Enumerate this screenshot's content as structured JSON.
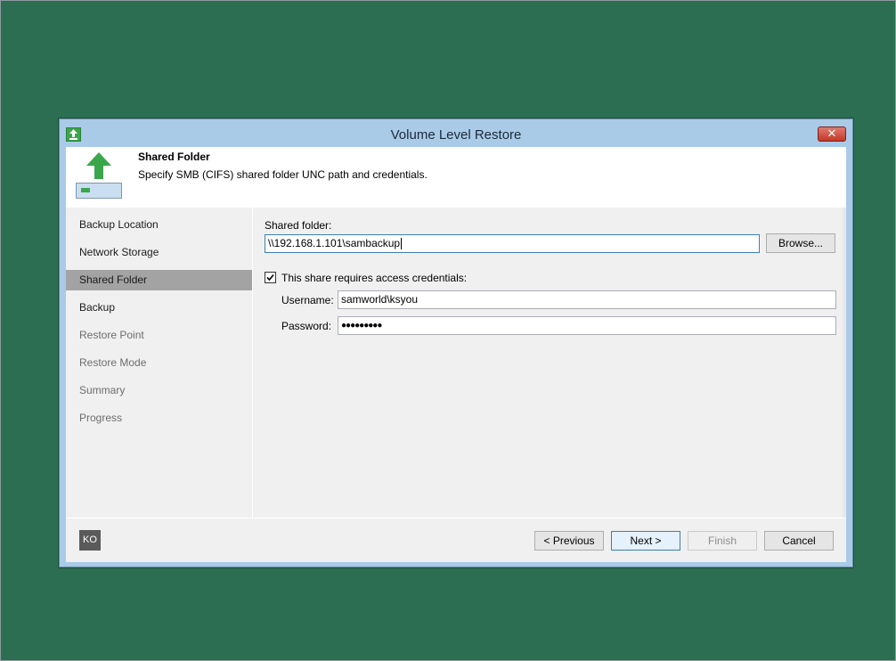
{
  "window": {
    "title": "Volume Level Restore",
    "close_glyph": "✕"
  },
  "header": {
    "title": "Shared Folder",
    "description": "Specify SMB (CIFS) shared folder UNC path and credentials.",
    "icon": "upload-arrow-drive-icon"
  },
  "nav": {
    "items": [
      {
        "label": "Backup Location",
        "state": "done"
      },
      {
        "label": "Network Storage",
        "state": "done"
      },
      {
        "label": "Shared Folder",
        "state": "active"
      },
      {
        "label": "Backup",
        "state": "done"
      },
      {
        "label": "Restore Point",
        "state": "pending"
      },
      {
        "label": "Restore Mode",
        "state": "pending"
      },
      {
        "label": "Summary",
        "state": "pending"
      },
      {
        "label": "Progress",
        "state": "pending"
      }
    ]
  },
  "form": {
    "shared_folder_label": "Shared folder:",
    "shared_folder_value": "\\\\192.168.1.101\\sambackup",
    "browse_label": "Browse...",
    "credentials_checkbox_label": "This share requires access credentials:",
    "credentials_checked": true,
    "username_label": "Username:",
    "username_value": "samworld\\ksyou",
    "password_label": "Password:",
    "password_value": "●●●●●●●●●"
  },
  "footer": {
    "badge": "KO",
    "previous_label": "< Previous",
    "next_label": "Next >",
    "finish_label": "Finish",
    "cancel_label": "Cancel"
  },
  "colors": {
    "desktop": "#2b6e52",
    "window_frame": "#a9cbe8",
    "active_nav": "#a3a3a3",
    "accent_green": "#3aa64a"
  }
}
